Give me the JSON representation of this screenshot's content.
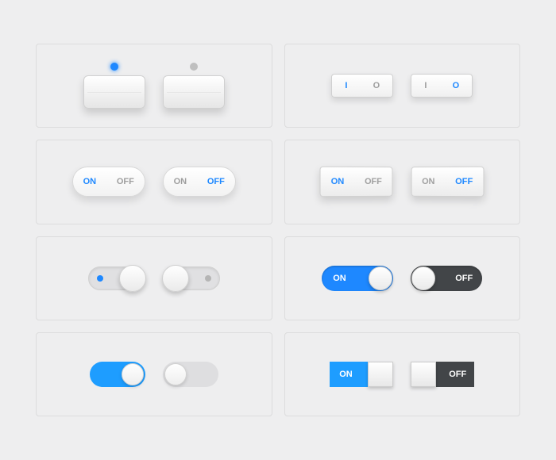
{
  "labels": {
    "on": "ON",
    "off": "OFF",
    "i": "I",
    "o": "O"
  },
  "colors": {
    "accent": "#1e88ff",
    "accent_light": "#1e9dff",
    "dark": "#424548"
  },
  "switches": {
    "row1_left": [
      {
        "state": "on"
      },
      {
        "state": "off"
      }
    ],
    "row1_right": [
      {
        "state": "on"
      },
      {
        "state": "off"
      }
    ],
    "row2_left": [
      {
        "active": "on"
      },
      {
        "active": "off"
      }
    ],
    "row2_right": [
      {
        "active": "on"
      },
      {
        "active": "off"
      }
    ],
    "row3_left": [
      {
        "state": "on"
      },
      {
        "state": "off"
      }
    ],
    "row3_right": [
      {
        "state": "on"
      },
      {
        "state": "off"
      }
    ],
    "row4_left": [
      {
        "state": "on"
      },
      {
        "state": "off"
      }
    ],
    "row4_right": [
      {
        "state": "on"
      },
      {
        "state": "off"
      }
    ]
  }
}
